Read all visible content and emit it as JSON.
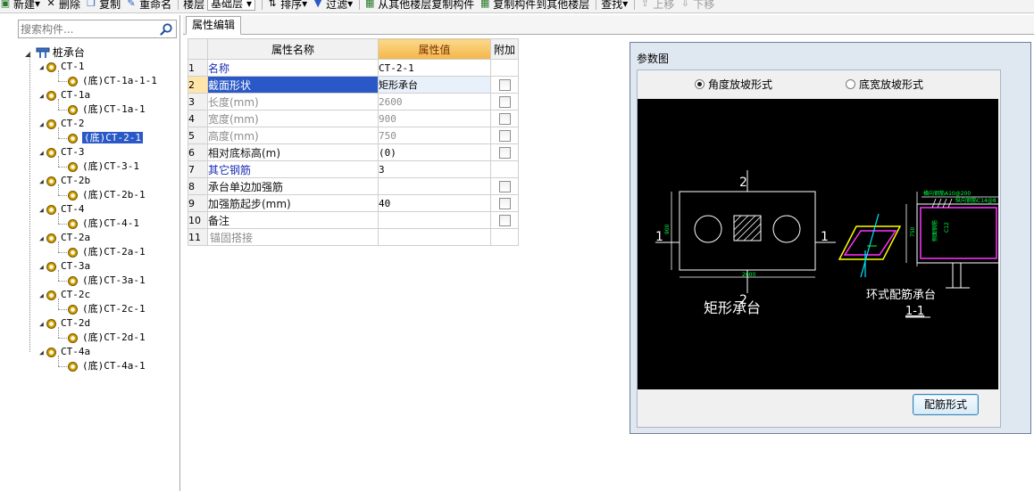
{
  "toolbar": {
    "new_label": "新建",
    "delete_label": "删除",
    "copy_label": "复制",
    "rename_label": "重命名",
    "floor_label": "楼层",
    "floor_value": "基础层",
    "sort_label": "排序",
    "filter_label": "过滤",
    "copy_from_label": "从其他楼层复制构件",
    "copy_to_label": "复制构件到其他楼层",
    "find_label": "查找",
    "move_up_label": "上移",
    "move_down_label": "下移"
  },
  "search": {
    "placeholder": "搜索构件..."
  },
  "tree": {
    "root": "桩承台",
    "groups": [
      {
        "name": "CT-1",
        "child": "(底)CT-1a-1-1"
      },
      {
        "name": "CT-1a",
        "child": "(底)CT-1a-1"
      },
      {
        "name": "CT-2",
        "child": "(底)CT-2-1",
        "selected": true
      },
      {
        "name": "CT-3",
        "child": "(底)CT-3-1"
      },
      {
        "name": "CT-2b",
        "child": "(底)CT-2b-1"
      },
      {
        "name": "CT-4",
        "child": "(底)CT-4-1"
      },
      {
        "name": "CT-2a",
        "child": "(底)CT-2a-1"
      },
      {
        "name": "CT-3a",
        "child": "(底)CT-3a-1"
      },
      {
        "name": "CT-2c",
        "child": "(底)CT-2c-1"
      },
      {
        "name": "CT-2d",
        "child": "(底)CT-2d-1"
      },
      {
        "name": "CT-4a",
        "child": "(底)CT-4a-1"
      }
    ]
  },
  "tab": {
    "label": "属性编辑"
  },
  "grid": {
    "headers": {
      "name": "属性名称",
      "value": "属性值",
      "extra": "附加"
    },
    "rows": [
      {
        "num": "1",
        "name": "名称",
        "value": "CT-2-1",
        "checkbox": false
      },
      {
        "num": "2",
        "name": "截面形状",
        "value": "矩形承台",
        "checkbox": true
      },
      {
        "num": "3",
        "name": "长度(mm)",
        "value": "2600",
        "checkbox": true
      },
      {
        "num": "4",
        "name": "宽度(mm)",
        "value": "900",
        "checkbox": true
      },
      {
        "num": "5",
        "name": "高度(mm)",
        "value": "750",
        "checkbox": true
      },
      {
        "num": "6",
        "name": "相对底标高(m)",
        "value": "(0)",
        "checkbox": true
      },
      {
        "num": "7",
        "name": "其它钢筋",
        "value": "3",
        "checkbox": false
      },
      {
        "num": "8",
        "name": "承台单边加强筋",
        "value": "",
        "checkbox": true
      },
      {
        "num": "9",
        "name": "加强筋起步(mm)",
        "value": "40",
        "checkbox": true
      },
      {
        "num": "10",
        "name": "备注",
        "value": "",
        "checkbox": true
      },
      {
        "num": "11",
        "name": "锚固搭接",
        "value": "",
        "checkbox": false
      }
    ]
  },
  "dialog": {
    "title": "参数图",
    "radio_angle": "角度放坡形式",
    "radio_bottom": "底宽放坡形式",
    "button": "配筋形式",
    "drawing": {
      "section_mark": "2",
      "side_mark": "1",
      "width_dim": "900",
      "length_dim": "2600",
      "height_dim": "750",
      "plan_label": "矩形承台",
      "section_label": "环式配筋承台",
      "section_id": "1-1",
      "rebar_note_1": "横向钢筋A10@200",
      "rebar_note_2": "纵向钢筋C14@8",
      "side_bar": "侧面钢筋",
      "top_bar": "C12"
    }
  }
}
